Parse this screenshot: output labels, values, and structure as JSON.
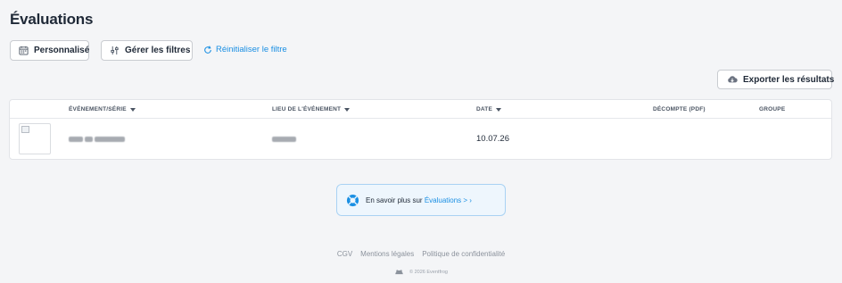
{
  "page": {
    "title": "Évaluations"
  },
  "toolbar": {
    "custom_label": "Personnalisé",
    "filters_label": "Gérer les filtres",
    "reset_label": "Réinitialiser le filtre",
    "export_label": "Exporter les résultats"
  },
  "table": {
    "columns": [
      {
        "label": "ÉVÉNEMENT/SÉRIE",
        "sortable": true
      },
      {
        "label": "LIEU DE L'ÉVÉNEMENT",
        "sortable": true
      },
      {
        "label": "DATE",
        "sortable": true
      },
      {
        "label": "DÉCOMPTE (PDF)",
        "sortable": false
      },
      {
        "label": "GROUPE",
        "sortable": false
      }
    ],
    "rows": [
      {
        "date": "10.07.26"
      }
    ]
  },
  "info": {
    "text": "En savoir plus sur ",
    "link": "Évaluations > ",
    "chevron": "›"
  },
  "footer": {
    "links": [
      "CGV",
      "Mentions légales",
      "Politique de confidentialité"
    ],
    "copyright": "© 2026 Eventfrog"
  },
  "colors": {
    "accent": "#1a8fe3",
    "background": "#f4f5f7",
    "banner_bg": "#eef6fd",
    "banner_border": "#a9d2f3"
  },
  "icons": {
    "custom": "calendar-icon",
    "filters": "sliders-icon",
    "reset": "refresh-icon",
    "export": "cloud-download-icon",
    "info": "lifebuoy-icon",
    "footer": "frog-logo-icon"
  }
}
